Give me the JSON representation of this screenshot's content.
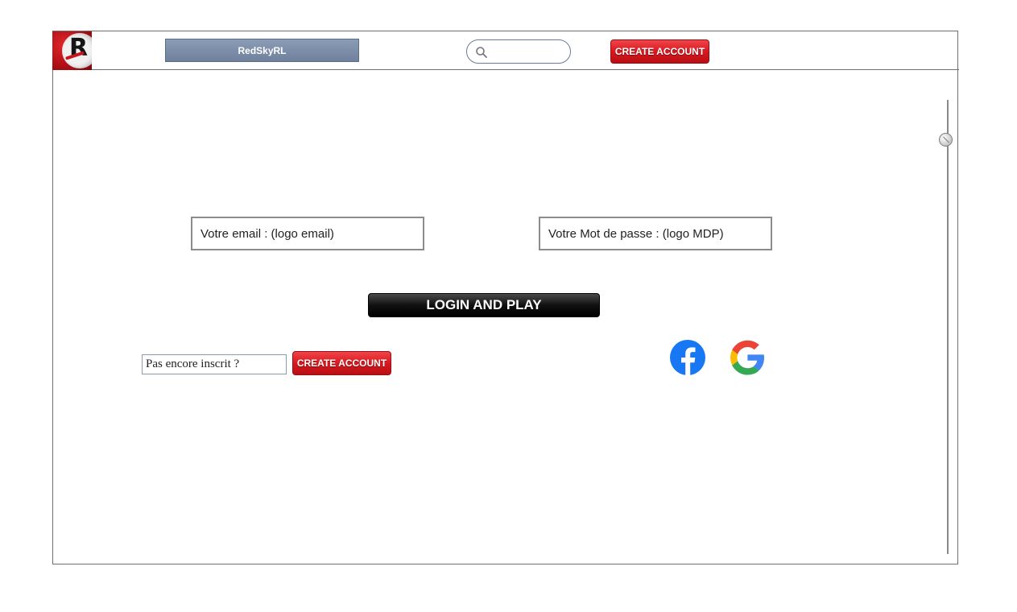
{
  "header": {
    "site_title": "RedSkyRL",
    "search": {
      "placeholder": "",
      "icon": "search-icon"
    },
    "create_account_label": "CREATE ACCOUNT",
    "logo_icon": "redsky-logo-icon"
  },
  "login_form": {
    "email_field_text": "Votre email : (logo email)",
    "password_field_text": "Votre Mot de passe : (logo MDP)",
    "login_button_label": "LOGIN AND PLAY"
  },
  "signup": {
    "prompt": "Pas encore inscrit ?",
    "create_account_label": "CREATE ACCOUNT"
  },
  "social": [
    {
      "name": "facebook",
      "icon": "facebook-icon",
      "color": "#1877F2"
    },
    {
      "name": "google",
      "icon": "google-icon"
    }
  ],
  "colors": {
    "accent_red": "#d8191f",
    "title_bar": "#7a8ca8",
    "login_button": "#000000"
  }
}
